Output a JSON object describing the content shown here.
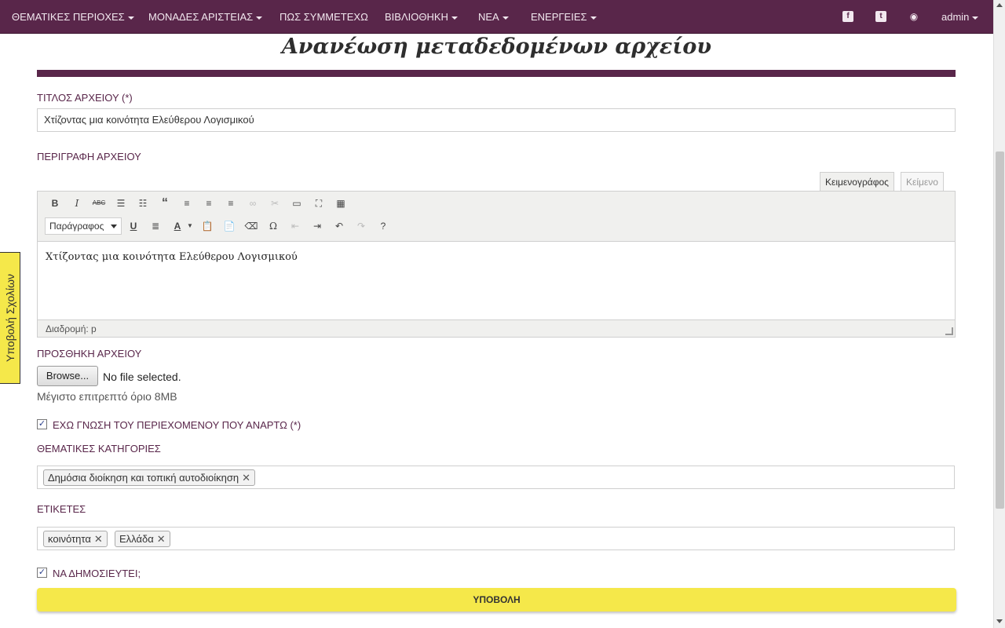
{
  "nav": {
    "items": [
      {
        "label": "ΘΕΜΑΤΙΚΕΣ ΠΕΡΙΟΧΕΣ",
        "dropdown": true
      },
      {
        "label": "ΜΟΝΑΔΕΣ ΑΡΙΣΤΕΙΑΣ",
        "dropdown": true
      },
      {
        "label": "ΠΩΣ ΣΥΜΜΕΤΕΧΩ",
        "dropdown": false
      },
      {
        "label": "ΒΙΒΛΙΟΘΗΚΗ",
        "dropdown": true
      },
      {
        "label": "ΝΕΑ",
        "dropdown": true
      },
      {
        "label": "ΕΝΕΡΓΕΙΕΣ",
        "dropdown": true
      }
    ],
    "social_icons": [
      "facebook-icon",
      "twitter-icon",
      "rss-icon"
    ],
    "user": "admin",
    "background_color": "#59264a"
  },
  "page": {
    "title": "Ανανέωση μεταδεδομένων αρχείου"
  },
  "form": {
    "file_title_label": "ΤΙΤΛΟΣ ΑΡΧΕΙΟΥ (*)",
    "file_title_value": "Χτίζοντας μια κοινότητα Ελεύθερου Λογισμικού",
    "description_label": "ΠΕΡΙΓΡΑΦΗ ΑΡΧΕΙΟΥ",
    "editor": {
      "tab_visual": "Κειμενογράφος",
      "tab_text": "Κείμενο",
      "format_select": "Παράγραφος",
      "content": "Χτίζοντας μια κοινότητα Ελεύθερου Λογισμικού",
      "path": "Διαδρομή: p",
      "toolbar_row1": [
        "bold-icon",
        "italic-icon",
        "strikethrough-icon",
        "bullet-list-icon",
        "numbered-list-icon",
        "blockquote-icon",
        "align-left-icon",
        "align-center-icon",
        "align-right-icon",
        "link-icon",
        "unlink-icon",
        "more-tag-icon",
        "fullscreen-icon",
        "toolbar-toggle-icon"
      ],
      "toolbar_row2": [
        "underline-icon",
        "justify-icon",
        "text-color-icon",
        "paste-text-icon",
        "paste-word-icon",
        "clear-format-icon",
        "special-char-icon",
        "outdent-icon",
        "indent-icon",
        "undo-icon",
        "redo-icon",
        "help-icon"
      ]
    },
    "attachment_label": "ΠΡΟΣΘΗΚΗ ΑΡΧΕΙΟΥ",
    "browse_label": "Browse...",
    "file_status": "No file selected.",
    "max_size_hint": "Μέγιστο επιτρεπτό όριο 8MB",
    "acknowledge_label": "ΕΧΩ ΓΝΩΣΗ ΤΟΥ ΠΕΡΙΕΧΟΜΕΝΟΥ ΠΟΥ ΑΝΑΡΤΩ (*)",
    "acknowledge_checked": true,
    "categories_label": "ΘΕΜΑΤΙΚΕΣ ΚΑΤΗΓΟΡΙΕΣ",
    "categories": [
      "Δημόσια διοίκηση και τοπική αυτοδιοίκηση"
    ],
    "tags_label": "ΕΤΙΚΕΤΕΣ",
    "tags": [
      "κοινότητα",
      "Ελλάδα"
    ],
    "publish_label": "ΝΑ ΔΗΜΟΣΙΕΥΤΕΙ;",
    "publish_checked": true,
    "submit_label": "ΥΠΟΒΟΛΗ",
    "submit_color": "#f5e84a"
  },
  "feedback_tab": {
    "label": "Υποβολή Σχολίων"
  }
}
